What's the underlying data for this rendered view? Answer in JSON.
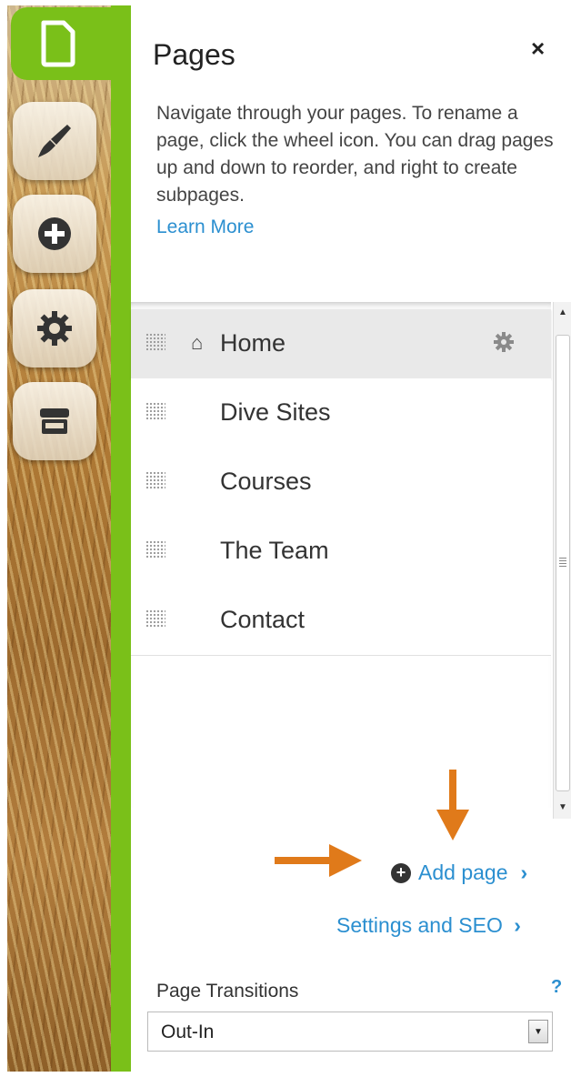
{
  "panel": {
    "title": "Pages",
    "close_label": "×",
    "description": "Navigate through your pages. To rename a page, click the wheel icon. You can drag pages up and down to reorder, and right to create subpages.",
    "learn_more": "Learn More"
  },
  "toolbar": {
    "items": [
      {
        "icon": "page-icon",
        "active": true
      },
      {
        "icon": "brush-icon",
        "active": false
      },
      {
        "icon": "plus-circle-icon",
        "active": false
      },
      {
        "icon": "gear-icon",
        "active": false
      },
      {
        "icon": "store-icon",
        "active": false
      }
    ]
  },
  "pages": [
    {
      "label": "Home",
      "is_home": true
    },
    {
      "label": "Dive Sites",
      "is_home": false
    },
    {
      "label": "Courses",
      "is_home": false
    },
    {
      "label": "The Team",
      "is_home": false
    },
    {
      "label": "Contact",
      "is_home": false
    }
  ],
  "actions": {
    "add_page": "Add page",
    "add_page_chevron": "›",
    "settings_seo": "Settings and SEO",
    "settings_seo_chevron": "›"
  },
  "transitions": {
    "label": "Page Transitions",
    "help": "?",
    "selected": "Out-In"
  },
  "colors": {
    "accent_green": "#7ac019",
    "link_blue": "#2b8fd0",
    "annotation_orange": "#e07a1a"
  }
}
